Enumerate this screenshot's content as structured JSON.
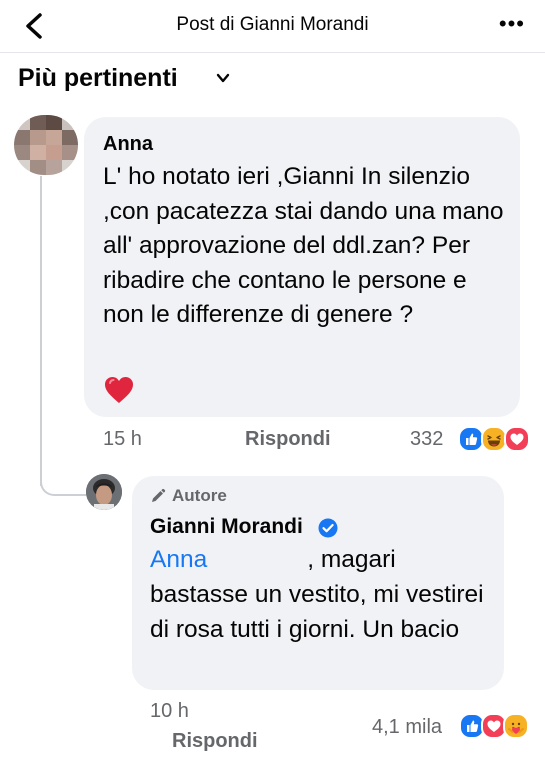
{
  "header": {
    "title": "Post di Gianni Morandi",
    "back_icon": "chevron-left-icon",
    "more_label": "•••"
  },
  "sort": {
    "label": "Più pertinenti",
    "icon": "chevron-down-icon"
  },
  "comment": {
    "author": "Anna",
    "text": "L' ho notato ieri ,Gianni In silenzio ,con pacatezza stai dando una mano all' approvazione del ddl.zan? Per ribadire che contano le persone e non le differenze di genere ?",
    "emoji": "heart-emoji",
    "time": "15 h",
    "reply_label": "Rispondi",
    "reaction_count": "332",
    "reactions": [
      "like-reaction",
      "haha-reaction",
      "love-reaction"
    ]
  },
  "reply": {
    "author_tag": "Autore",
    "author": "Gianni Morandi",
    "verified": true,
    "mention": "Anna",
    "text": ", magari bastasse un vestito, mi vestirei di rosa tutti i giorni. Un bacio",
    "time": "10 h",
    "reply_label": "Rispondi",
    "reaction_count": "4,1 mila",
    "reactions": [
      "like-reaction",
      "love-reaction",
      "care-reaction"
    ]
  },
  "colors": {
    "accent": "#1877f2",
    "bubble": "#f0f2f5",
    "meta": "#65676b",
    "love": "#f33e58",
    "haha": "#f7b125"
  }
}
